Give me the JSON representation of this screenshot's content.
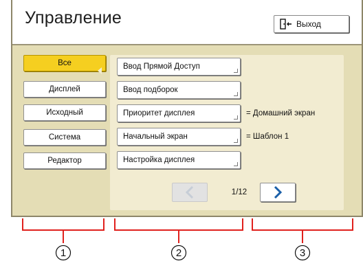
{
  "header": {
    "title": "Управление",
    "exit_label": "Выход"
  },
  "nav": {
    "items": [
      {
        "label": "Все",
        "active": true
      },
      {
        "label": "Дисплей",
        "active": false
      },
      {
        "label": "Исходный",
        "active": false
      },
      {
        "label": "Система",
        "active": false
      },
      {
        "label": "Редактор",
        "active": false
      }
    ]
  },
  "settings": [
    {
      "label": "Ввод Прямой Доступ",
      "value": ""
    },
    {
      "label": "Ввод подборок",
      "value": ""
    },
    {
      "label": "Приоритет дисплея",
      "value": "= Домашний экран"
    },
    {
      "label": "Начальный экран",
      "value": "= Шаблон 1"
    },
    {
      "label": "Настройка дисплея",
      "value": ""
    }
  ],
  "pager": {
    "page": "1/12",
    "prev_enabled": false,
    "next_enabled": true
  },
  "callouts": [
    "1",
    "2",
    "3"
  ],
  "colors": {
    "background": "#e4ddb5",
    "panel": "#f2ecd1",
    "active": "#f5cf20",
    "next_arrow": "#1a5fa8",
    "bracket": "#e0201c"
  },
  "icons": {
    "exit": "exit-door-icon",
    "prev": "chevron-left-icon",
    "next": "chevron-right-icon"
  }
}
